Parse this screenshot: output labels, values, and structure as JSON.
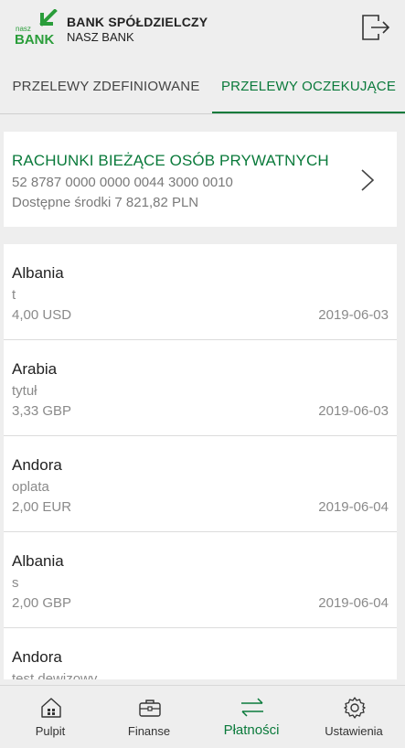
{
  "header": {
    "logo_small": "nasz",
    "logo_big": "BANK",
    "bank_name": "BANK SPÓŁDZIELCZY",
    "bank_subtitle": "NASZ BANK",
    "logout_icon": "logout-icon"
  },
  "tabs": [
    {
      "label": "PRZELEWY ZDEFINIOWANE",
      "active": false
    },
    {
      "label": "PRZELEWY OCZEKUJĄCE",
      "active": true
    }
  ],
  "account": {
    "title": "RACHUNKI BIEŻĄCE OSÓB PRYWATNYCH",
    "number": "52 8787 0000 0000 0044 3000 0010",
    "balance_label": "Dostępne środki",
    "balance_value": "7 821,82 PLN"
  },
  "transfers": [
    {
      "name": "Albania",
      "title": "t",
      "amount": "4,00 USD",
      "date": "2019-06-03"
    },
    {
      "name": "Arabia",
      "title": "tytuł",
      "amount": "3,33 GBP",
      "date": "2019-06-03"
    },
    {
      "name": "Andora",
      "title": "oplata",
      "amount": "2,00 EUR",
      "date": "2019-06-04"
    },
    {
      "name": "Albania",
      "title": "s",
      "amount": "2,00 GBP",
      "date": "2019-06-04"
    },
    {
      "name": "Andora",
      "title": "test dewizowy",
      "amount": "",
      "date": ""
    }
  ],
  "nav": [
    {
      "label": "Pulpit",
      "icon": "home-icon",
      "active": false
    },
    {
      "label": "Finanse",
      "icon": "briefcase-icon",
      "active": false
    },
    {
      "label": "Płatności",
      "icon": "transfer-arrows-icon",
      "active": true
    },
    {
      "label": "Ustawienia",
      "icon": "gear-icon",
      "active": false
    }
  ],
  "colors": {
    "accent": "#0a7a3b",
    "background": "#eeeeee",
    "card": "#ffffff",
    "muted_text": "#8a8a8a"
  }
}
